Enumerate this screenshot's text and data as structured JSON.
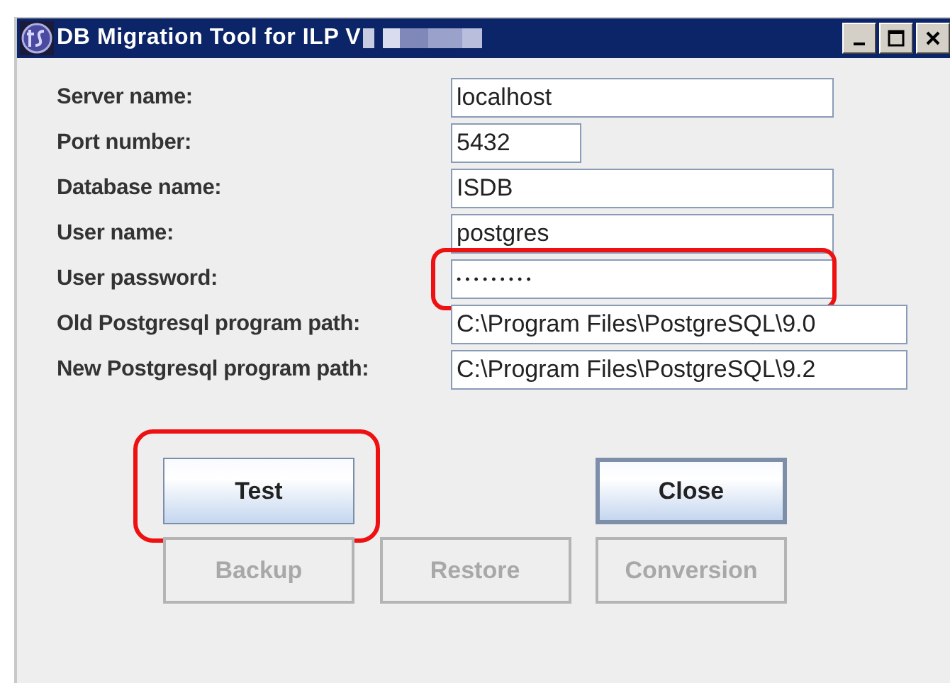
{
  "window": {
    "title": "DB Migration Tool for ILP V",
    "title_redacted": true
  },
  "fields": [
    {
      "label": "Server name:",
      "value": "localhost",
      "kind": "text",
      "highlighted": false
    },
    {
      "label": "Port number:",
      "value": "5432",
      "kind": "number",
      "highlighted": false
    },
    {
      "label": "Database name:",
      "value": "ISDB",
      "kind": "text",
      "highlighted": false
    },
    {
      "label": "User name:",
      "value": "postgres",
      "kind": "text",
      "highlighted": false
    },
    {
      "label": "User password:",
      "value": "•••••••••",
      "kind": "password",
      "highlighted": true
    },
    {
      "label": "Old Postgresql program path:",
      "value": "C:\\Program Files\\PostgreSQL\\9.0",
      "kind": "path",
      "highlighted": false
    },
    {
      "label": "New Postgresql program path:",
      "value": "C:\\Program Files\\PostgreSQL\\9.2",
      "kind": "path",
      "highlighted": false
    }
  ],
  "button_rows": [
    [
      {
        "label": "Test",
        "disabled": false,
        "default": false,
        "highlighted": true
      },
      {
        "label": "Close",
        "disabled": false,
        "default": true,
        "highlighted": false
      }
    ],
    [
      {
        "label": "Backup",
        "disabled": true,
        "default": false,
        "highlighted": false
      },
      {
        "label": "Restore",
        "disabled": true,
        "default": false,
        "highlighted": false
      },
      {
        "label": "Conversion",
        "disabled": true,
        "default": false,
        "highlighted": false
      }
    ]
  ]
}
